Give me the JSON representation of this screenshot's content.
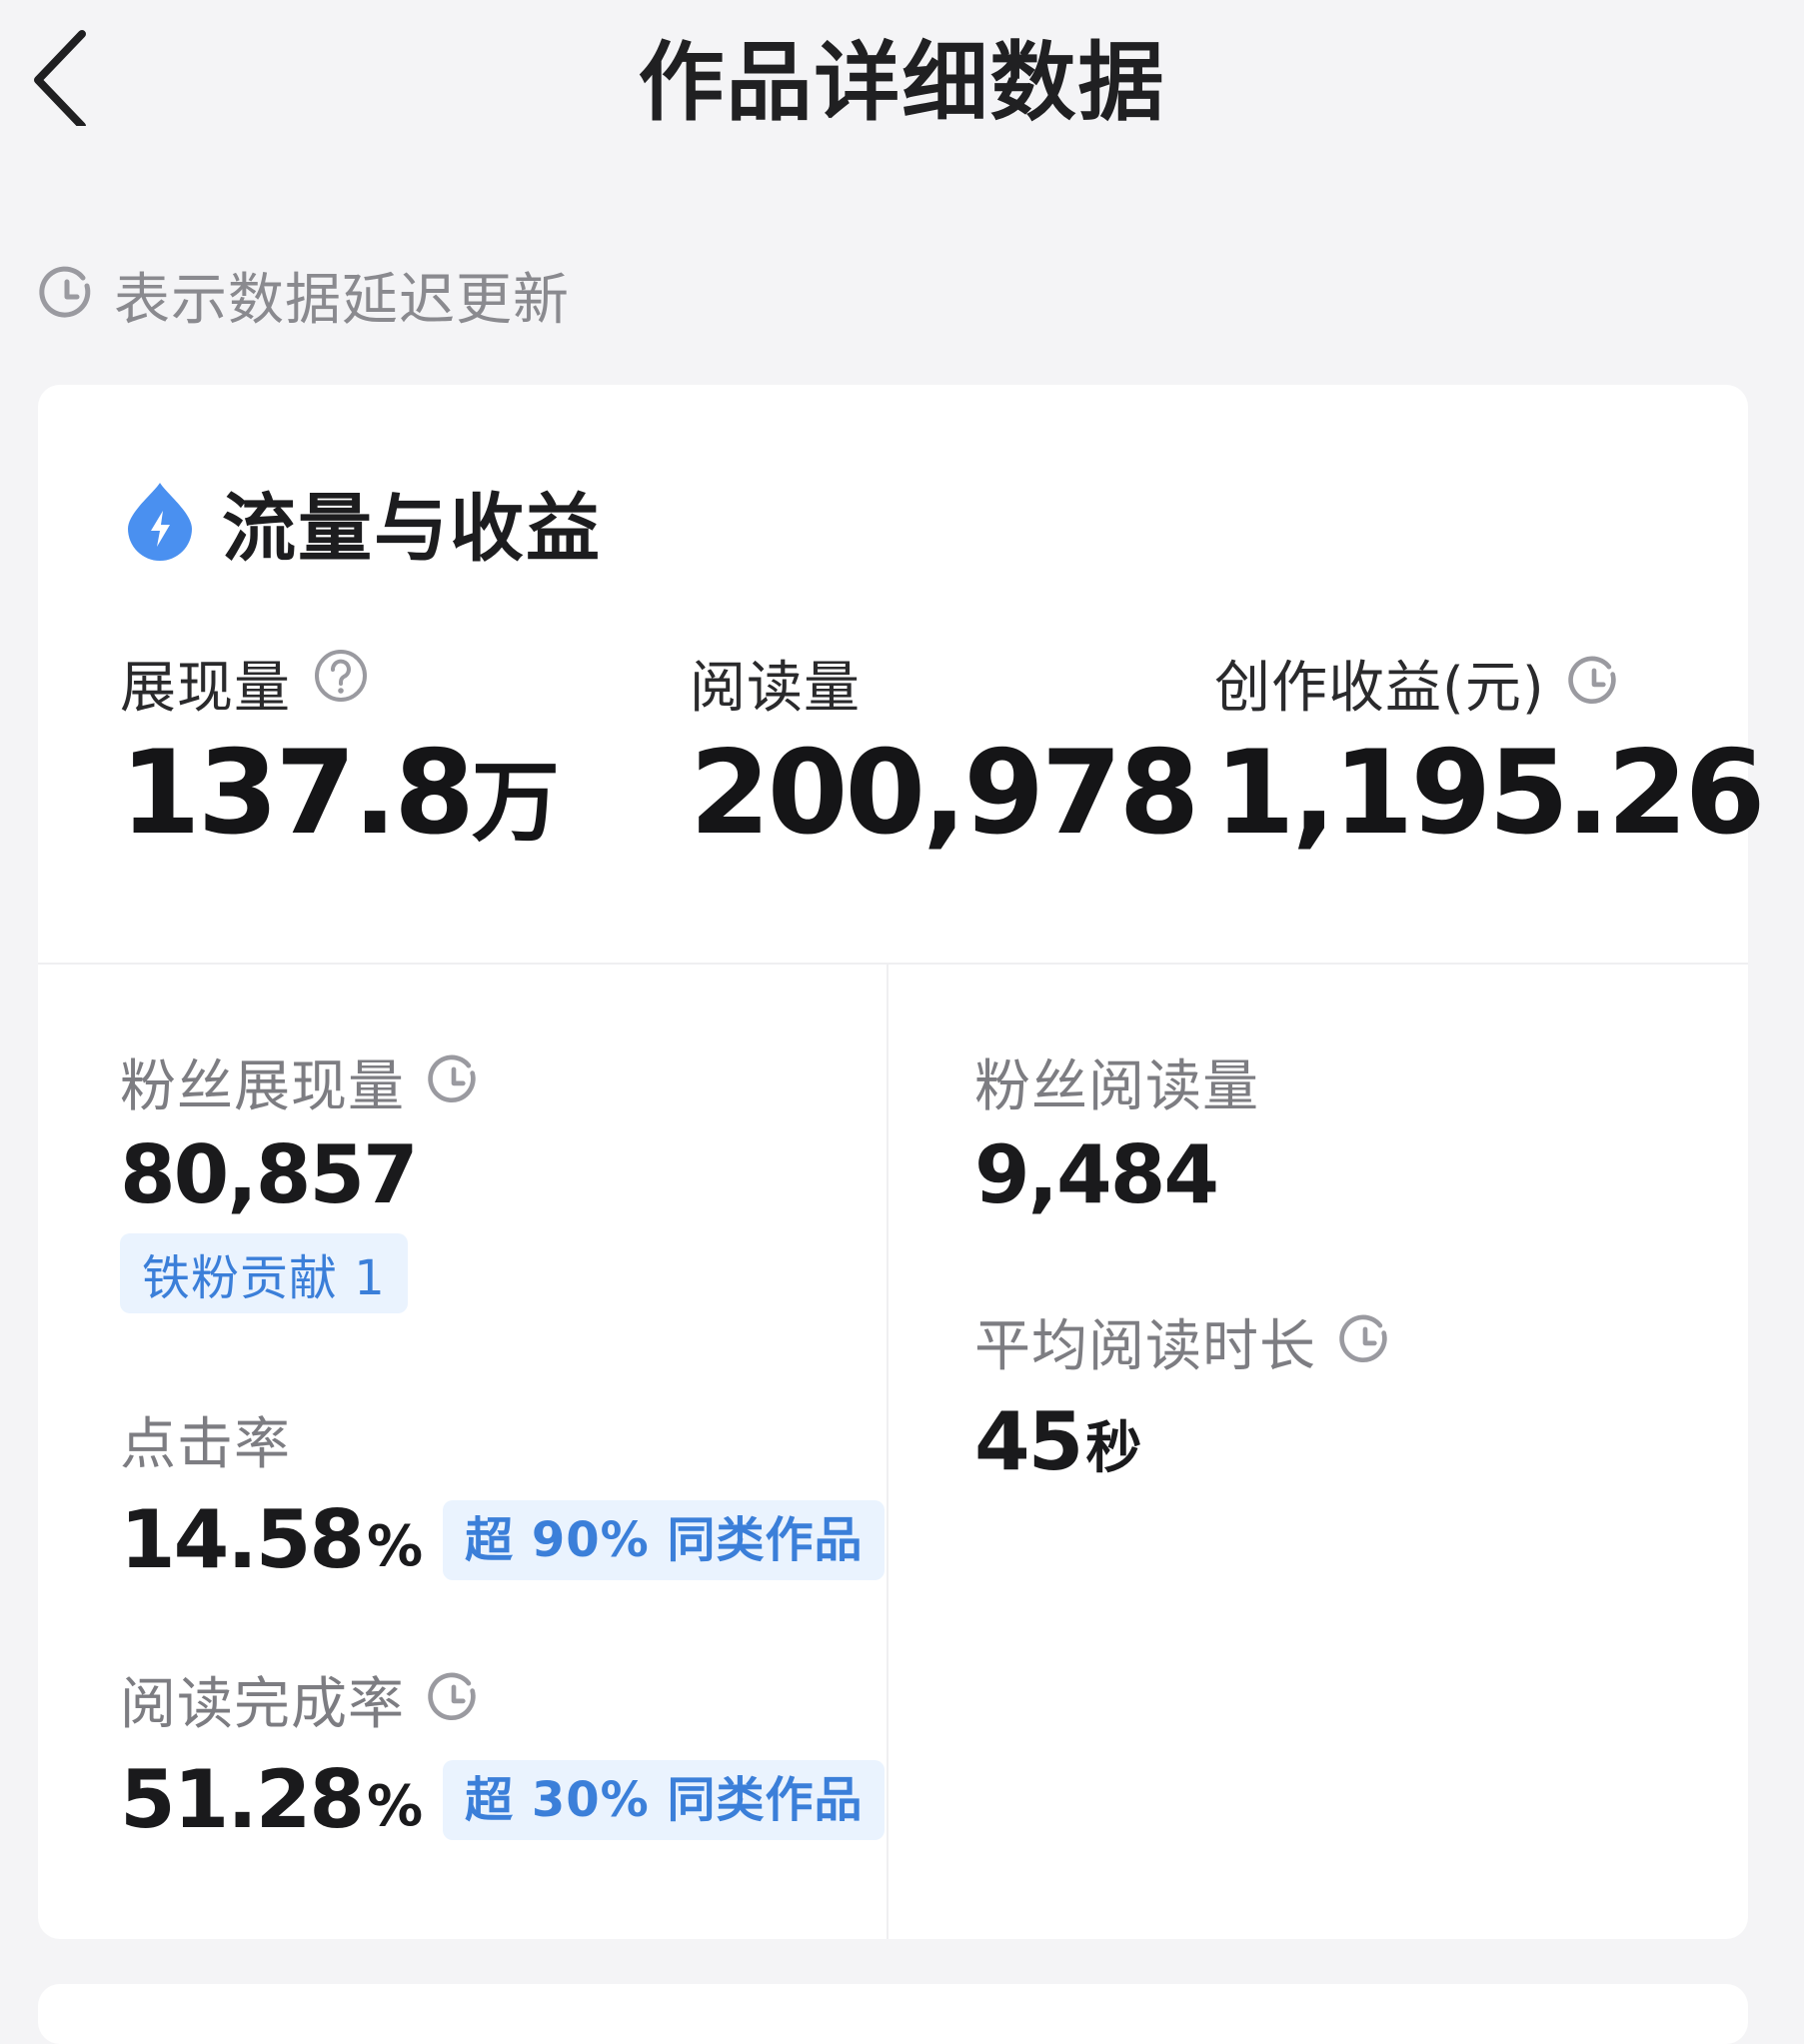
{
  "header": {
    "title": "作品详细数据"
  },
  "hint": {
    "text": "表示数据延迟更新"
  },
  "section": {
    "title": "流量与收益",
    "icon_color": "#4a90f0"
  },
  "main_metrics": [
    {
      "label": "展现量",
      "value": "137.8",
      "unit": "万"
    },
    {
      "label": "阅读量",
      "value": "200,978"
    },
    {
      "label": "创作收益(元)",
      "value": "1,195.26"
    }
  ],
  "fan_impressions": {
    "label": "粉丝展现量",
    "value": "80,857",
    "badge": "铁粉贡献 1"
  },
  "fan_reads": {
    "label": "粉丝阅读量",
    "value": "9,484"
  },
  "click_rate": {
    "label": "点击率",
    "value": "14.58",
    "unit": "%",
    "compare": "超 90% 同类作品"
  },
  "avg_read_time": {
    "label": "平均阅读时长",
    "value": "45",
    "unit": "秒"
  },
  "completion_rate": {
    "label": "阅读完成率",
    "value": "51.28",
    "unit": "%",
    "compare": "超 30% 同类作品"
  },
  "colors": {
    "accent": "#3b7fd9",
    "badge_bg": "#eaf3fe",
    "page_bg": "#f4f4f6"
  }
}
